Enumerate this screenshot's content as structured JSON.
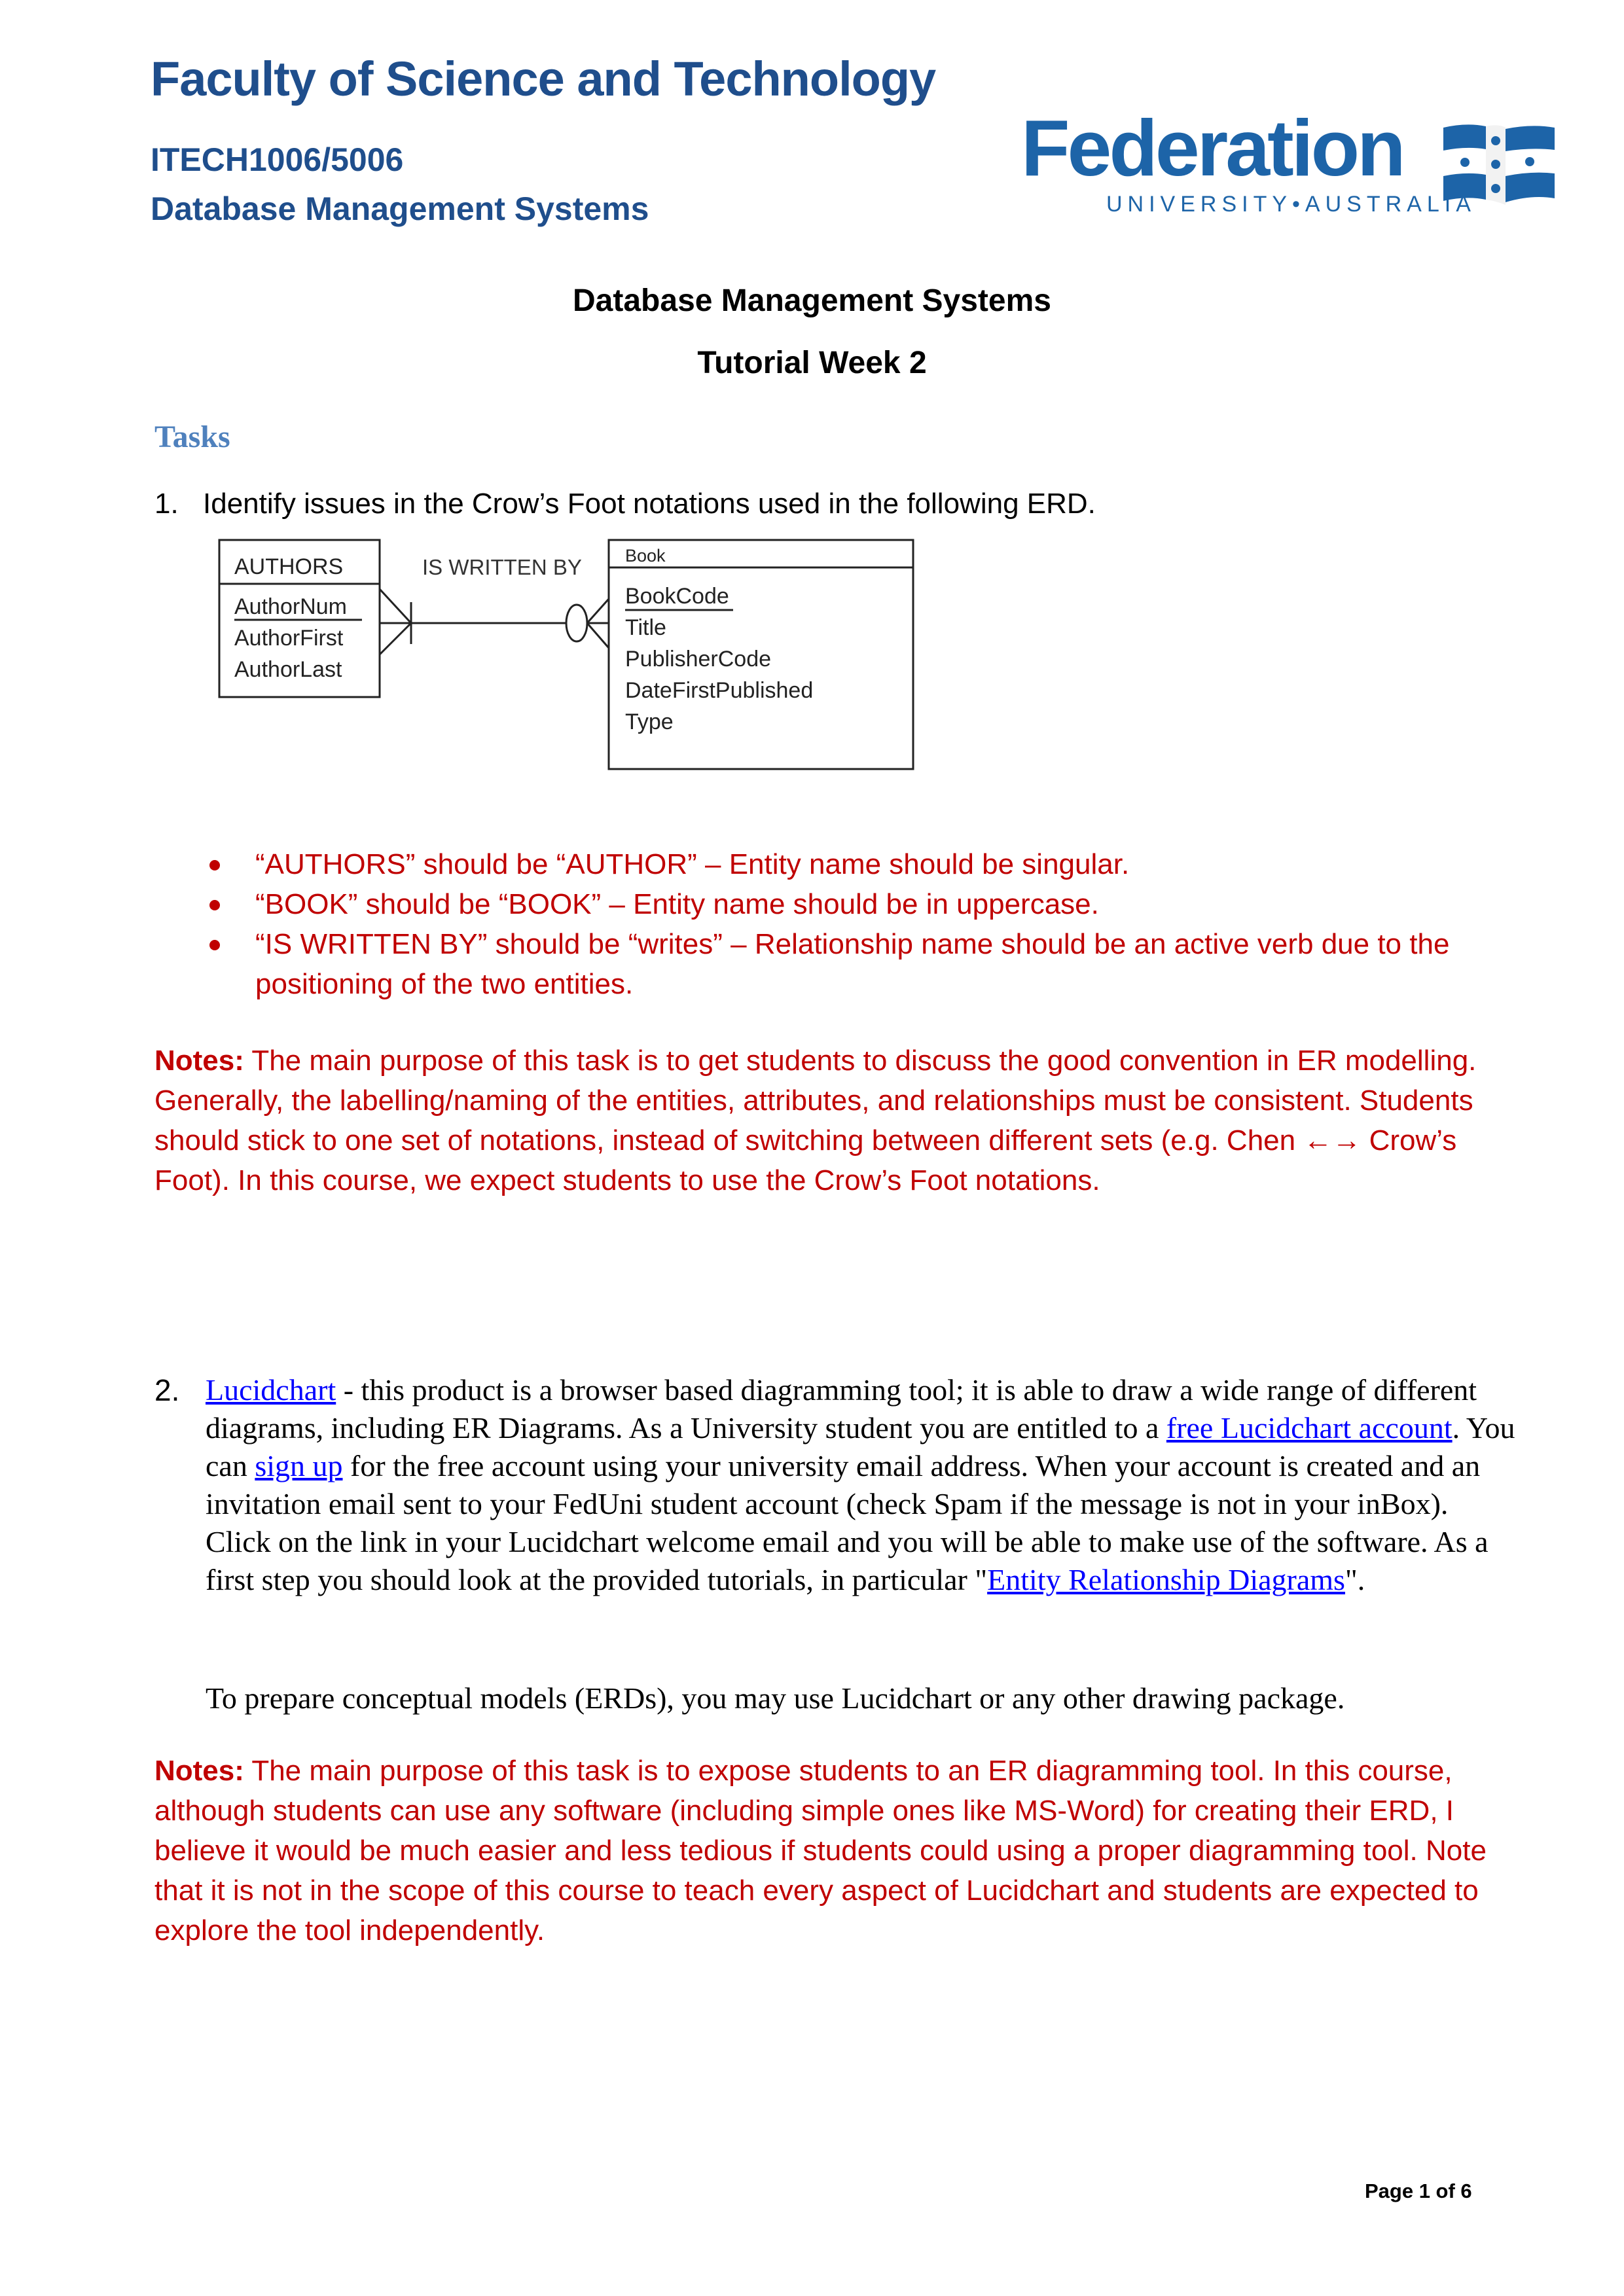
{
  "header": {
    "faculty": "Faculty of Science and Technology",
    "course_code": "ITECH1006/5006",
    "course_name": "Database Management Systems",
    "logo": {
      "name": "Federation",
      "subtitle": "UNIVERSITY•AUSTRALIA",
      "flag_icon": "federation-flag-icon",
      "brand_color": "#1d64a8"
    }
  },
  "document": {
    "title": "Database Management Systems",
    "subtitle": "Tutorial Week 2",
    "section_heading": "Tasks"
  },
  "task1": {
    "number": "1.",
    "prompt": "Identify issues in the Crow’s Foot notations used in the following ERD.",
    "erd": {
      "entity_left": {
        "name": "AUTHORS",
        "attributes": [
          "AuthorNum",
          "AuthorFirst",
          "AuthorLast"
        ],
        "primary_key": "AuthorNum"
      },
      "relationship": "IS WRITTEN BY",
      "entity_right": {
        "name": "Book",
        "attributes": [
          "BookCode",
          "Title",
          "PublisherCode",
          "DateFirstPublished",
          "Type"
        ],
        "primary_key": "BookCode"
      }
    },
    "answers": [
      " “AUTHORS” should be “AUTHOR” – Entity name should be singular.",
      "“BOOK” should be “BOOK” – Entity name should be in uppercase.",
      "“IS WRITTEN BY” should be “writes” – Relationship name should be an active verb due to the positioning of the two entities."
    ],
    "notes_label": "Notes:",
    "notes_text": " The main purpose of this task is to get students to discuss the good convention in ER modelling. Generally, the labelling/naming of the entities, attributes, and relationships must be consistent. Students should stick to one set of notations, instead of switching between different sets (e.g. Chen ←→ Crow’s Foot). In this course, we expect students to use the Crow’s Foot notations."
  },
  "task2": {
    "number": "2.",
    "link_lucidchart": "Lucidchart",
    "text_1": " - this product is a browser based diagramming tool; it is able to draw a wide range of different diagrams, including ER Diagrams. As a University student you are entitled to a ",
    "link_free_account": "free Lucidchart account",
    "text_2": ". You can ",
    "link_sign_up": "sign up",
    "text_3": " for the free account using your university email address. When your account is created and an invitation email sent to your FedUni student account (check Spam if the message is not in your inBox). Click on the link in your Lucidchart welcome email and you will be able to make use of the software. As a first step you should look at the provided tutorials, in particular \"",
    "link_erd": "Entity Relationship Diagrams",
    "text_4": "\".",
    "extra": "To prepare conceptual models (ERDs), you may use Lucidchart or any other drawing package.",
    "notes_label": "Notes:",
    "notes_text": " The main purpose of this task is to expose students to an ER diagramming tool. In this course, although students can use any software (including simple ones like MS-Word) for creating their ERD, I believe it would be much easier and less tedious if students could using a proper diagramming tool. Note that it is not in the scope of this course to teach every aspect of Lucidchart and students are expected to explore the tool independently."
  },
  "footer": {
    "page_label": "Page 1 of 6"
  },
  "colors": {
    "header_blue": "#1f4e8c",
    "heading_blue": "#4f81bd",
    "notes_red": "#c00000",
    "link_blue": "#0000ff"
  }
}
